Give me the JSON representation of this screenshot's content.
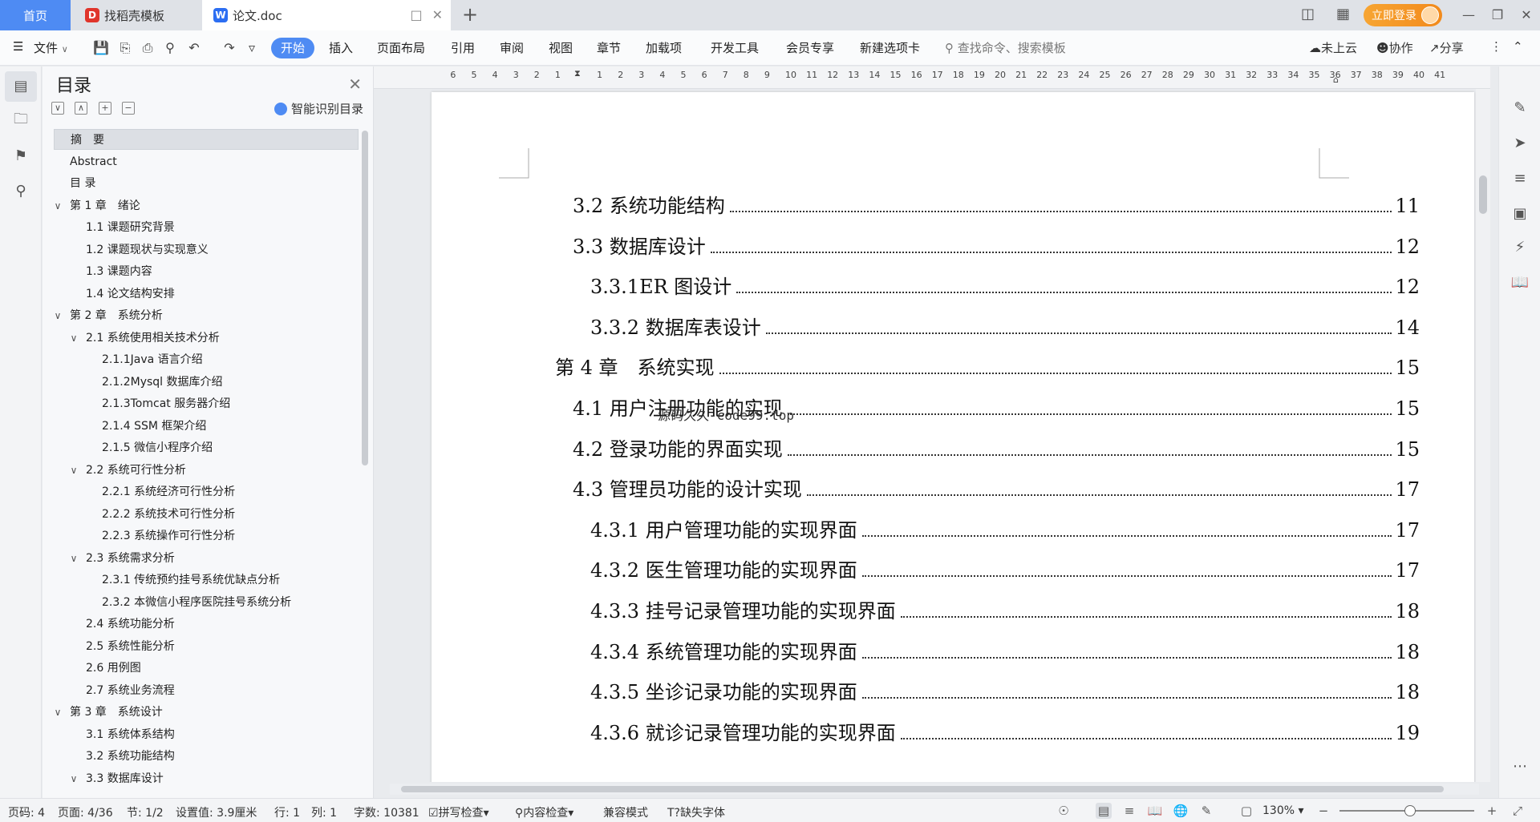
{
  "titlebar": {
    "home_tab": "首页",
    "tabs": [
      {
        "label": "找稻壳模板",
        "icon": "daoke-icon"
      },
      {
        "label": "论文.doc",
        "icon": "wps-writer-icon"
      }
    ],
    "login_label": "立即登录"
  },
  "menu": {
    "file_label": "文件",
    "items": [
      "开始",
      "插入",
      "页面布局",
      "引用",
      "审阅",
      "视图",
      "章节",
      "加载项",
      "开发工具",
      "会员专享",
      "新建选项卡"
    ],
    "active": "开始",
    "search_placeholder": "查找命令、搜索模板",
    "cloud_label": "未上云",
    "collab_label": "协作",
    "share_label": "分享"
  },
  "toc_panel": {
    "title": "目录",
    "ai_label": "智能识别目录",
    "items": [
      {
        "label": "摘　要",
        "level": 0,
        "chevron": "",
        "selected": true
      },
      {
        "label": "Abstract",
        "level": 0,
        "chevron": ""
      },
      {
        "label": "目 录",
        "level": 0,
        "chevron": ""
      },
      {
        "label": "第 1 章　绪论",
        "level": 0,
        "chevron": "v"
      },
      {
        "label": "1.1 课题研究背景",
        "level": 1,
        "chevron": ""
      },
      {
        "label": "1.2 课题现状与实现意义",
        "level": 1,
        "chevron": ""
      },
      {
        "label": "1.3 课题内容",
        "level": 1,
        "chevron": ""
      },
      {
        "label": "1.4 论文结构安排",
        "level": 1,
        "chevron": ""
      },
      {
        "label": "第 2 章　系统分析",
        "level": 0,
        "chevron": "v"
      },
      {
        "label": "2.1 系统使用相关技术分析",
        "level": 1,
        "chevron": "v"
      },
      {
        "label": "2.1.1Java 语言介绍",
        "level": 2,
        "chevron": ""
      },
      {
        "label": "2.1.2Mysql 数据库介绍",
        "level": 2,
        "chevron": ""
      },
      {
        "label": "2.1.3Tomcat 服务器介绍",
        "level": 2,
        "chevron": ""
      },
      {
        "label": "2.1.4 SSM 框架介绍",
        "level": 2,
        "chevron": ""
      },
      {
        "label": "2.1.5 微信小程序介绍",
        "level": 2,
        "chevron": ""
      },
      {
        "label": "2.2 系统可行性分析",
        "level": 1,
        "chevron": "v"
      },
      {
        "label": "2.2.1 系统经济可行性分析",
        "level": 2,
        "chevron": ""
      },
      {
        "label": "2.2.2 系统技术可行性分析",
        "level": 2,
        "chevron": ""
      },
      {
        "label": "2.2.3 系统操作可行性分析",
        "level": 2,
        "chevron": ""
      },
      {
        "label": "2.3 系统需求分析",
        "level": 1,
        "chevron": "v"
      },
      {
        "label": "2.3.1 传统预约挂号系统优缺点分析",
        "level": 2,
        "chevron": ""
      },
      {
        "label": "2.3.2 本微信小程序医院挂号系统分析",
        "level": 2,
        "chevron": ""
      },
      {
        "label": "2.4 系统功能分析",
        "level": 1,
        "chevron": ""
      },
      {
        "label": "2.5 系统性能分析",
        "level": 1,
        "chevron": ""
      },
      {
        "label": "2.6 用例图",
        "level": 1,
        "chevron": ""
      },
      {
        "label": "2.7 系统业务流程",
        "level": 1,
        "chevron": ""
      },
      {
        "label": "第 3 章　系统设计",
        "level": 0,
        "chevron": "v"
      },
      {
        "label": "3.1 系统体系结构",
        "level": 1,
        "chevron": ""
      },
      {
        "label": "3.2 系统功能结构",
        "level": 1,
        "chevron": ""
      },
      {
        "label": "3.3 数据库设计",
        "level": 1,
        "chevron": "v"
      }
    ]
  },
  "ruler": {
    "left_numbers": [
      "6",
      "5",
      "4",
      "3",
      "2",
      "1"
    ],
    "right_numbers": [
      "1",
      "2",
      "3",
      "4",
      "5",
      "6",
      "7",
      "8",
      "9",
      "10",
      "11",
      "12",
      "13",
      "14",
      "15",
      "16",
      "17",
      "18",
      "19",
      "20",
      "21",
      "22",
      "23",
      "24",
      "25",
      "26",
      "27",
      "28",
      "29",
      "30",
      "31",
      "32",
      "33",
      "34",
      "35",
      "36",
      "37",
      "38",
      "39",
      "40",
      "41"
    ]
  },
  "document": {
    "lines": [
      {
        "text": "3.2 系统功能结构",
        "page": "11",
        "level": 1
      },
      {
        "text": "3.3 数据库设计",
        "page": "12",
        "level": 1
      },
      {
        "text": "3.3.1ER 图设计",
        "page": "12",
        "level": 2
      },
      {
        "text": "3.3.2 数据库表设计",
        "page": "14",
        "level": 2
      },
      {
        "text": "第 4 章　系统实现",
        "page": "15",
        "level": 0
      },
      {
        "text": "4.1 用户注册功能的实现",
        "page": "15",
        "level": 1
      },
      {
        "text": "4.2 登录功能的界面实现",
        "page": "15",
        "level": 1
      },
      {
        "text": "4.3 管理员功能的设计实现",
        "page": "17",
        "level": 1
      },
      {
        "text": "4.3.1 用户管理功能的实现界面",
        "page": "17",
        "level": 2
      },
      {
        "text": "4.3.2 医生管理功能的实现界面",
        "page": "17",
        "level": 2
      },
      {
        "text": "4.3.3  挂号记录管理功能的实现界面",
        "page": "18",
        "level": 2
      },
      {
        "text": "4.3.4 系统管理功能的实现界面",
        "page": "18",
        "level": 2
      },
      {
        "text": "4.3.5 坐诊记录功能的实现界面",
        "page": "18",
        "level": 2
      },
      {
        "text": "4.3.6 就诊记录管理功能的实现界面",
        "page": "19",
        "level": 2
      }
    ],
    "watermark": "源码久久-code99.top"
  },
  "status": {
    "page_code": "页码: 4",
    "page_of": "页面: 4/36",
    "section": "节: 1/2",
    "setting": "设置值: 3.9厘米",
    "row": "行: 1",
    "col": "列: 1",
    "word_count": "字数: 10381",
    "spell_check": "拼写检查",
    "content_check": "内容检查",
    "compat_mode": "兼容模式",
    "missing_font": "缺失字体",
    "zoom": "130%"
  },
  "colors": {
    "accent": "#4e8bf3",
    "login": "#f28a1c"
  }
}
